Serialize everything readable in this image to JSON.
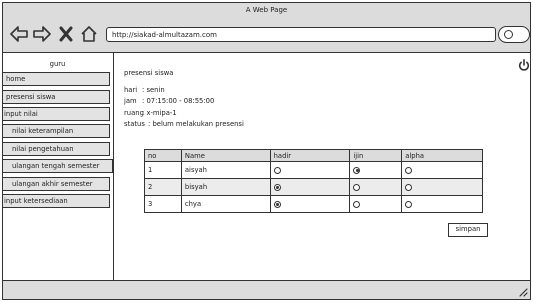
{
  "window": {
    "title": "A Web Page"
  },
  "browser": {
    "url": "http://siakad-almultazam.com"
  },
  "sidebar": {
    "header": "guru",
    "items": [
      {
        "label": "home"
      },
      {
        "label": "presensi siswa"
      },
      {
        "label": "input nilai"
      },
      {
        "label": "nilai keterampilan"
      },
      {
        "label": "nilai pengetahuan"
      },
      {
        "label": "ulangan tengah semester"
      },
      {
        "label": "ulangan akhir semester"
      },
      {
        "label": "input ketersediaan"
      }
    ]
  },
  "main": {
    "page_title": "presensi siswa",
    "info": {
      "hari": {
        "label": "hari",
        "value": ": senin"
      },
      "jam": {
        "label": "jam",
        "value": ": 07:15:00 - 08:55:00"
      },
      "ruang": {
        "label": "ruang",
        "value": ": x-mipa-1"
      },
      "status": {
        "label": "status",
        "value": ": belum melakukan presensi"
      }
    },
    "table": {
      "headers": [
        "no",
        "Name",
        "hadir",
        "ijin",
        "alpha"
      ],
      "rows": [
        {
          "no": "1",
          "name": "aisyah",
          "selected": "ijin"
        },
        {
          "no": "2",
          "name": "bisyah",
          "selected": "hadir"
        },
        {
          "no": "3",
          "name": "chya",
          "selected": "hadir"
        }
      ]
    },
    "save_label": "simpan"
  }
}
